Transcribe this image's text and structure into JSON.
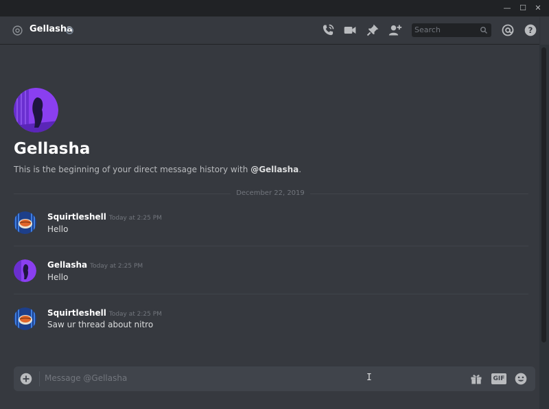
{
  "window": {
    "minimize": "—",
    "maximize": "☐",
    "close": "✕"
  },
  "header": {
    "title": "Gellasha",
    "search_placeholder": "Search",
    "icons": [
      "at-icon",
      "call-icon",
      "video-icon",
      "pin-icon",
      "add-friend-icon",
      "search-icon",
      "mention-icon",
      "help-icon"
    ]
  },
  "intro": {
    "name": "Gellasha",
    "text_prefix": "This is the beginning of your direct message history with ",
    "mention": "@Gellasha",
    "text_suffix": "."
  },
  "date_divider": "December 22, 2019",
  "messages": [
    {
      "author": "Squirtleshell",
      "timestamp": "Today at 2:25 PM",
      "text": "Hello"
    },
    {
      "author": "Gellasha",
      "timestamp": "Today at 2:25 PM",
      "text": "Hello"
    },
    {
      "author": "Squirtleshell",
      "timestamp": "Today at 2:25 PM",
      "text": "Saw ur thread about nitro"
    }
  ],
  "composer": {
    "placeholder": "Message @Gellasha",
    "gif_label": "GIF"
  },
  "colors": {
    "background": "#36393f",
    "titlebar": "#202225",
    "input": "#40444b",
    "text": "#dcddde",
    "muted": "#72767d",
    "avatar_gellasha": "#7b3fe4",
    "avatar_squirtle": "#2a4f9e"
  }
}
